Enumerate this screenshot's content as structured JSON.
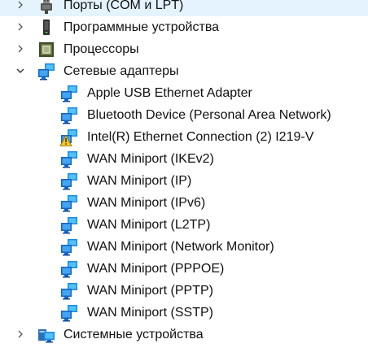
{
  "tree": {
    "before": [
      {
        "label": "Порты (COM и LPT)",
        "icon": "port-icon",
        "expanded": false
      },
      {
        "label": "Программные устройства",
        "icon": "software-device-icon",
        "expanded": false
      },
      {
        "label": "Процессоры",
        "icon": "processor-icon",
        "expanded": false
      }
    ],
    "network": {
      "label": "Сетевые адаптеры",
      "icon": "network-adapter-icon",
      "expanded": true,
      "children": [
        {
          "label": "Apple USB Ethernet Adapter",
          "icon": "network-adapter-icon",
          "warning": false
        },
        {
          "label": "Bluetooth Device (Personal Area Network)",
          "icon": "network-adapter-icon",
          "warning": false
        },
        {
          "label": "Intel(R) Ethernet Connection (2) I219-V",
          "icon": "network-adapter-warning-icon",
          "warning": true
        },
        {
          "label": "WAN Miniport (IKEv2)",
          "icon": "network-adapter-icon",
          "warning": false
        },
        {
          "label": "WAN Miniport (IP)",
          "icon": "network-adapter-icon",
          "warning": false
        },
        {
          "label": "WAN Miniport (IPv6)",
          "icon": "network-adapter-icon",
          "warning": false
        },
        {
          "label": "WAN Miniport (L2TP)",
          "icon": "network-adapter-icon",
          "warning": false
        },
        {
          "label": "WAN Miniport (Network Monitor)",
          "icon": "network-adapter-icon",
          "warning": false
        },
        {
          "label": "WAN Miniport (PPPOE)",
          "icon": "network-adapter-icon",
          "warning": false
        },
        {
          "label": "WAN Miniport (PPTP)",
          "icon": "network-adapter-icon",
          "warning": false
        },
        {
          "label": "WAN Miniport (SSTP)",
          "icon": "network-adapter-icon",
          "warning": false
        }
      ]
    },
    "after": [
      {
        "label": "Системные устройства",
        "icon": "system-device-icon",
        "expanded": false
      }
    ]
  },
  "colors": {
    "monitor_blue": "#1e88e5",
    "monitor_light": "#4fc3f7",
    "warning_yellow": "#f9c623",
    "chevron": "#555555",
    "hover": "#e5f3ff"
  }
}
